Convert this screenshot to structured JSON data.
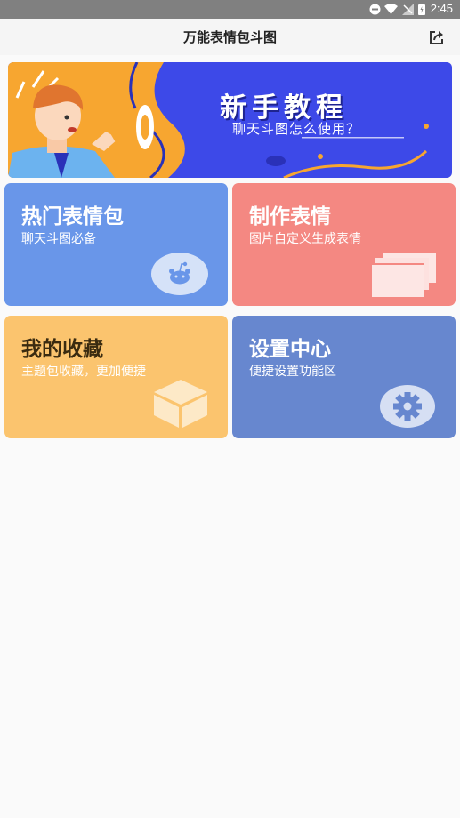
{
  "status_bar": {
    "time": "2:45"
  },
  "app_bar": {
    "title": "万能表情包斗图"
  },
  "banner": {
    "title": "新手教程",
    "subtitle": "聊天斗图怎么使用？"
  },
  "cards": [
    {
      "title": "热门表情包",
      "subtitle": "聊天斗图必备",
      "color": "#6996e9",
      "icon": "reddit-robot-icon"
    },
    {
      "title": "制作表情",
      "subtitle": "图片自定义生成表情",
      "color": "#f48882",
      "icon": "stacked-cards-icon"
    },
    {
      "title": "我的收藏",
      "subtitle": "主题包收藏，更加便捷",
      "color": "#fbc46e",
      "icon": "box-icon"
    },
    {
      "title": "设置中心",
      "subtitle": "便捷设置功能区",
      "color": "#6787cf",
      "icon": "gear-icon"
    }
  ]
}
